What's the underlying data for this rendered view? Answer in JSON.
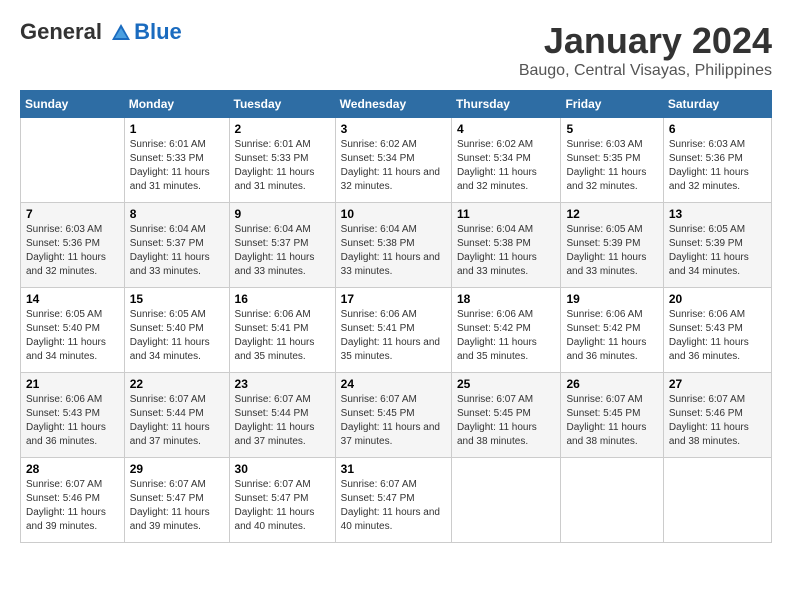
{
  "header": {
    "logo_line1": "General",
    "logo_line2": "Blue",
    "month": "January 2024",
    "location": "Baugo, Central Visayas, Philippines"
  },
  "weekdays": [
    "Sunday",
    "Monday",
    "Tuesday",
    "Wednesday",
    "Thursday",
    "Friday",
    "Saturday"
  ],
  "weeks": [
    [
      {
        "day": "",
        "sunrise": "",
        "sunset": "",
        "daylight": ""
      },
      {
        "day": "1",
        "sunrise": "Sunrise: 6:01 AM",
        "sunset": "Sunset: 5:33 PM",
        "daylight": "Daylight: 11 hours and 31 minutes."
      },
      {
        "day": "2",
        "sunrise": "Sunrise: 6:01 AM",
        "sunset": "Sunset: 5:33 PM",
        "daylight": "Daylight: 11 hours and 31 minutes."
      },
      {
        "day": "3",
        "sunrise": "Sunrise: 6:02 AM",
        "sunset": "Sunset: 5:34 PM",
        "daylight": "Daylight: 11 hours and 32 minutes."
      },
      {
        "day": "4",
        "sunrise": "Sunrise: 6:02 AM",
        "sunset": "Sunset: 5:34 PM",
        "daylight": "Daylight: 11 hours and 32 minutes."
      },
      {
        "day": "5",
        "sunrise": "Sunrise: 6:03 AM",
        "sunset": "Sunset: 5:35 PM",
        "daylight": "Daylight: 11 hours and 32 minutes."
      },
      {
        "day": "6",
        "sunrise": "Sunrise: 6:03 AM",
        "sunset": "Sunset: 5:36 PM",
        "daylight": "Daylight: 11 hours and 32 minutes."
      }
    ],
    [
      {
        "day": "7",
        "sunrise": "Sunrise: 6:03 AM",
        "sunset": "Sunset: 5:36 PM",
        "daylight": "Daylight: 11 hours and 32 minutes."
      },
      {
        "day": "8",
        "sunrise": "Sunrise: 6:04 AM",
        "sunset": "Sunset: 5:37 PM",
        "daylight": "Daylight: 11 hours and 33 minutes."
      },
      {
        "day": "9",
        "sunrise": "Sunrise: 6:04 AM",
        "sunset": "Sunset: 5:37 PM",
        "daylight": "Daylight: 11 hours and 33 minutes."
      },
      {
        "day": "10",
        "sunrise": "Sunrise: 6:04 AM",
        "sunset": "Sunset: 5:38 PM",
        "daylight": "Daylight: 11 hours and 33 minutes."
      },
      {
        "day": "11",
        "sunrise": "Sunrise: 6:04 AM",
        "sunset": "Sunset: 5:38 PM",
        "daylight": "Daylight: 11 hours and 33 minutes."
      },
      {
        "day": "12",
        "sunrise": "Sunrise: 6:05 AM",
        "sunset": "Sunset: 5:39 PM",
        "daylight": "Daylight: 11 hours and 33 minutes."
      },
      {
        "day": "13",
        "sunrise": "Sunrise: 6:05 AM",
        "sunset": "Sunset: 5:39 PM",
        "daylight": "Daylight: 11 hours and 34 minutes."
      }
    ],
    [
      {
        "day": "14",
        "sunrise": "Sunrise: 6:05 AM",
        "sunset": "Sunset: 5:40 PM",
        "daylight": "Daylight: 11 hours and 34 minutes."
      },
      {
        "day": "15",
        "sunrise": "Sunrise: 6:05 AM",
        "sunset": "Sunset: 5:40 PM",
        "daylight": "Daylight: 11 hours and 34 minutes."
      },
      {
        "day": "16",
        "sunrise": "Sunrise: 6:06 AM",
        "sunset": "Sunset: 5:41 PM",
        "daylight": "Daylight: 11 hours and 35 minutes."
      },
      {
        "day": "17",
        "sunrise": "Sunrise: 6:06 AM",
        "sunset": "Sunset: 5:41 PM",
        "daylight": "Daylight: 11 hours and 35 minutes."
      },
      {
        "day": "18",
        "sunrise": "Sunrise: 6:06 AM",
        "sunset": "Sunset: 5:42 PM",
        "daylight": "Daylight: 11 hours and 35 minutes."
      },
      {
        "day": "19",
        "sunrise": "Sunrise: 6:06 AM",
        "sunset": "Sunset: 5:42 PM",
        "daylight": "Daylight: 11 hours and 36 minutes."
      },
      {
        "day": "20",
        "sunrise": "Sunrise: 6:06 AM",
        "sunset": "Sunset: 5:43 PM",
        "daylight": "Daylight: 11 hours and 36 minutes."
      }
    ],
    [
      {
        "day": "21",
        "sunrise": "Sunrise: 6:06 AM",
        "sunset": "Sunset: 5:43 PM",
        "daylight": "Daylight: 11 hours and 36 minutes."
      },
      {
        "day": "22",
        "sunrise": "Sunrise: 6:07 AM",
        "sunset": "Sunset: 5:44 PM",
        "daylight": "Daylight: 11 hours and 37 minutes."
      },
      {
        "day": "23",
        "sunrise": "Sunrise: 6:07 AM",
        "sunset": "Sunset: 5:44 PM",
        "daylight": "Daylight: 11 hours and 37 minutes."
      },
      {
        "day": "24",
        "sunrise": "Sunrise: 6:07 AM",
        "sunset": "Sunset: 5:45 PM",
        "daylight": "Daylight: 11 hours and 37 minutes."
      },
      {
        "day": "25",
        "sunrise": "Sunrise: 6:07 AM",
        "sunset": "Sunset: 5:45 PM",
        "daylight": "Daylight: 11 hours and 38 minutes."
      },
      {
        "day": "26",
        "sunrise": "Sunrise: 6:07 AM",
        "sunset": "Sunset: 5:45 PM",
        "daylight": "Daylight: 11 hours and 38 minutes."
      },
      {
        "day": "27",
        "sunrise": "Sunrise: 6:07 AM",
        "sunset": "Sunset: 5:46 PM",
        "daylight": "Daylight: 11 hours and 38 minutes."
      }
    ],
    [
      {
        "day": "28",
        "sunrise": "Sunrise: 6:07 AM",
        "sunset": "Sunset: 5:46 PM",
        "daylight": "Daylight: 11 hours and 39 minutes."
      },
      {
        "day": "29",
        "sunrise": "Sunrise: 6:07 AM",
        "sunset": "Sunset: 5:47 PM",
        "daylight": "Daylight: 11 hours and 39 minutes."
      },
      {
        "day": "30",
        "sunrise": "Sunrise: 6:07 AM",
        "sunset": "Sunset: 5:47 PM",
        "daylight": "Daylight: 11 hours and 40 minutes."
      },
      {
        "day": "31",
        "sunrise": "Sunrise: 6:07 AM",
        "sunset": "Sunset: 5:47 PM",
        "daylight": "Daylight: 11 hours and 40 minutes."
      },
      {
        "day": "",
        "sunrise": "",
        "sunset": "",
        "daylight": ""
      },
      {
        "day": "",
        "sunrise": "",
        "sunset": "",
        "daylight": ""
      },
      {
        "day": "",
        "sunrise": "",
        "sunset": "",
        "daylight": ""
      }
    ]
  ]
}
